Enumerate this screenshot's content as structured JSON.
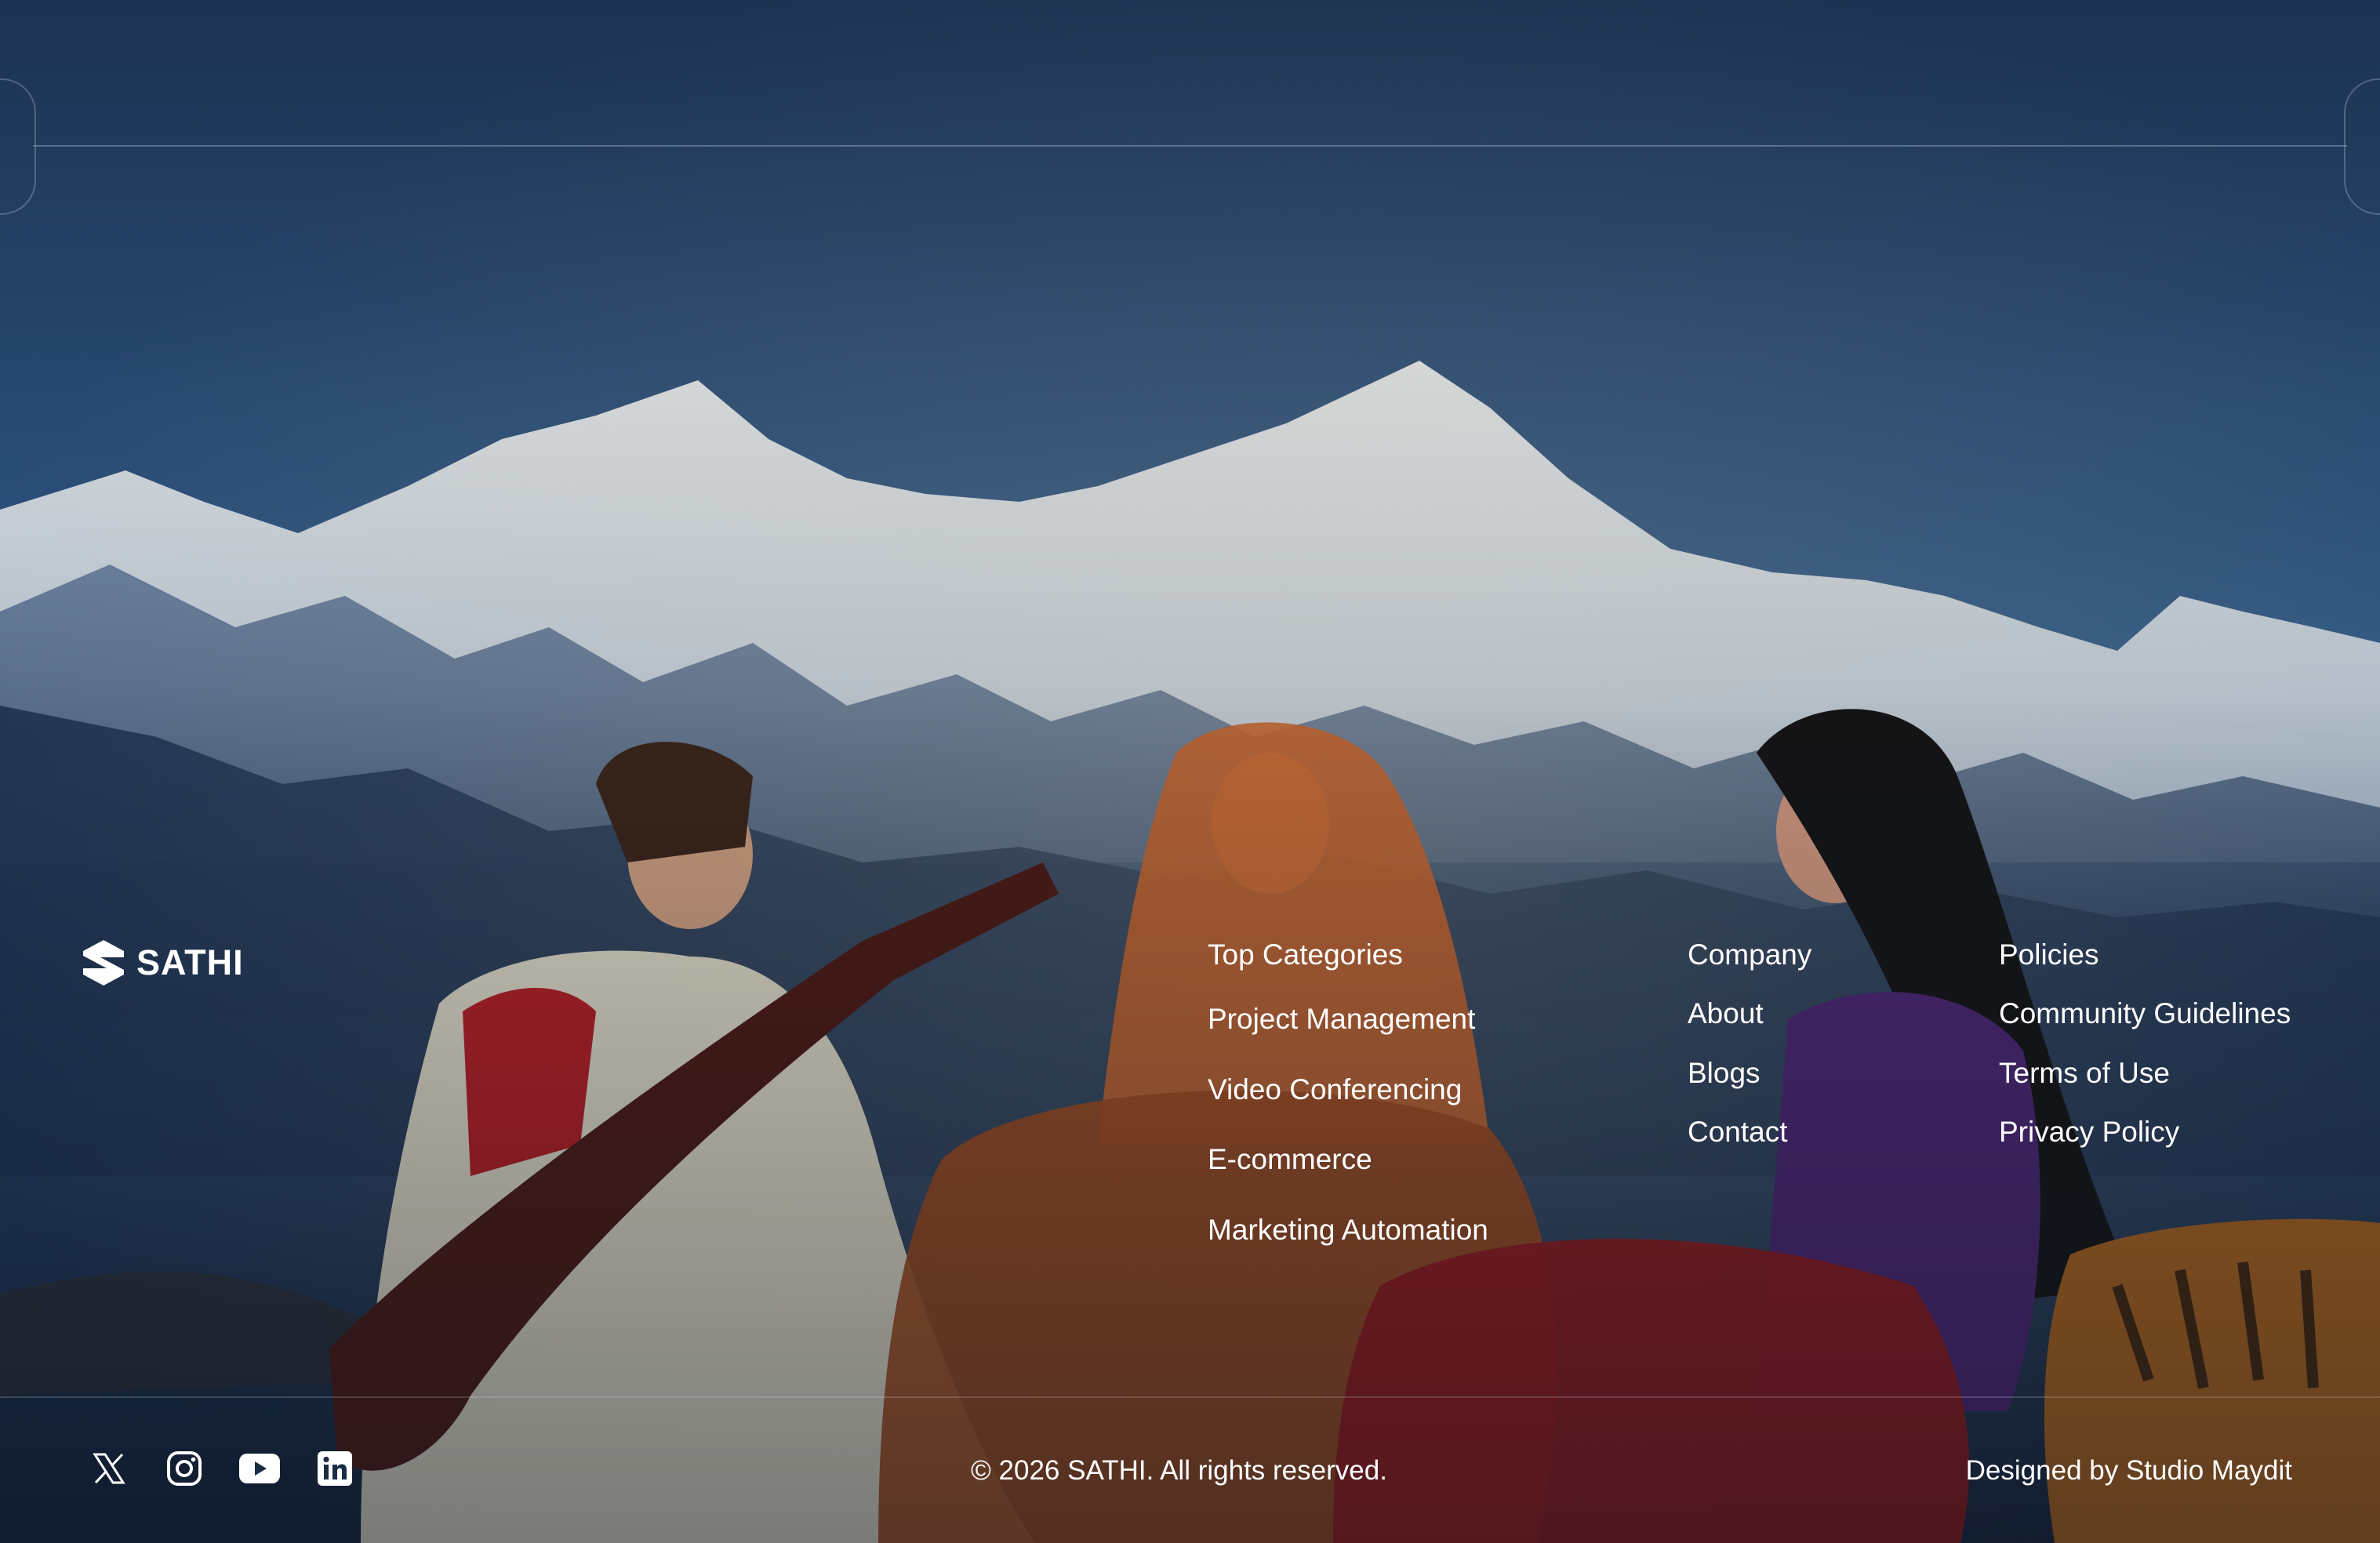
{
  "brand": {
    "name": "SATHI",
    "icon": "sathi-logo-icon"
  },
  "categories": {
    "heading": "Top Categories",
    "items": [
      "Project Management",
      "Video Conferencing",
      "E-commerce",
      "Marketing Automation"
    ]
  },
  "company": {
    "heading": "Company",
    "items": [
      "About",
      "Blogs",
      "Contact"
    ]
  },
  "policies": {
    "heading": "Policies",
    "items": [
      "Community Guidelines",
      "Terms of Use",
      "Privacy Policy"
    ]
  },
  "social": [
    {
      "icon": "x-twitter-icon"
    },
    {
      "icon": "instagram-icon"
    },
    {
      "icon": "youtube-icon"
    },
    {
      "icon": "linkedin-icon"
    }
  ],
  "footer": {
    "copyright": "© 2026 SATHI. All rights reserved.",
    "designed_by": "Designed by Studio Maydit"
  },
  "colors": {
    "text": "#ffffff",
    "sky": "#2d5480",
    "divider": "rgba(200,210,225,0.22)"
  }
}
